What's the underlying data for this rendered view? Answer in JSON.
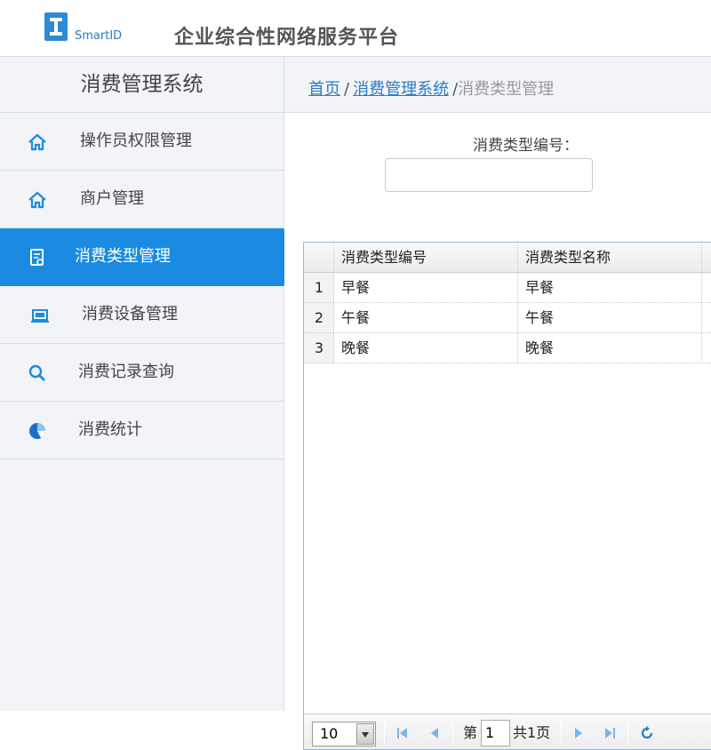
{
  "header": {
    "logo_text": "SmartID",
    "site_title": "企业综合性网络服务平台"
  },
  "sidebar": {
    "title": "消费管理系统",
    "items": [
      {
        "label": "操作员权限管理",
        "icon": "home-icon"
      },
      {
        "label": "商户管理",
        "icon": "home-icon"
      },
      {
        "label": "消费类型管理",
        "icon": "document-icon",
        "active": true
      },
      {
        "label": "消费设备管理",
        "icon": "monitor-icon"
      },
      {
        "label": "消费记录查询",
        "icon": "search-icon"
      },
      {
        "label": "消费统计",
        "icon": "pie-chart-icon"
      }
    ]
  },
  "breadcrumb": {
    "home": "首页",
    "sep": "/",
    "system": "消费管理系统",
    "current": "消费类型管理"
  },
  "search": {
    "label": "消费类型编号：",
    "value": ""
  },
  "grid": {
    "columns": [
      "消费类型编号",
      "消费类型名称"
    ],
    "rows": [
      {
        "num": "1",
        "code": "早餐",
        "name": "早餐"
      },
      {
        "num": "2",
        "code": "午餐",
        "name": "午餐"
      },
      {
        "num": "3",
        "code": "晚餐",
        "name": "晚餐"
      }
    ]
  },
  "pager": {
    "page_size": "10",
    "page_prefix": "第",
    "current_page": "1",
    "total_text": "共1页"
  },
  "colors": {
    "accent": "#1a8be0",
    "link": "#2a7bc6",
    "pager_icon": "#5aa0e0"
  }
}
